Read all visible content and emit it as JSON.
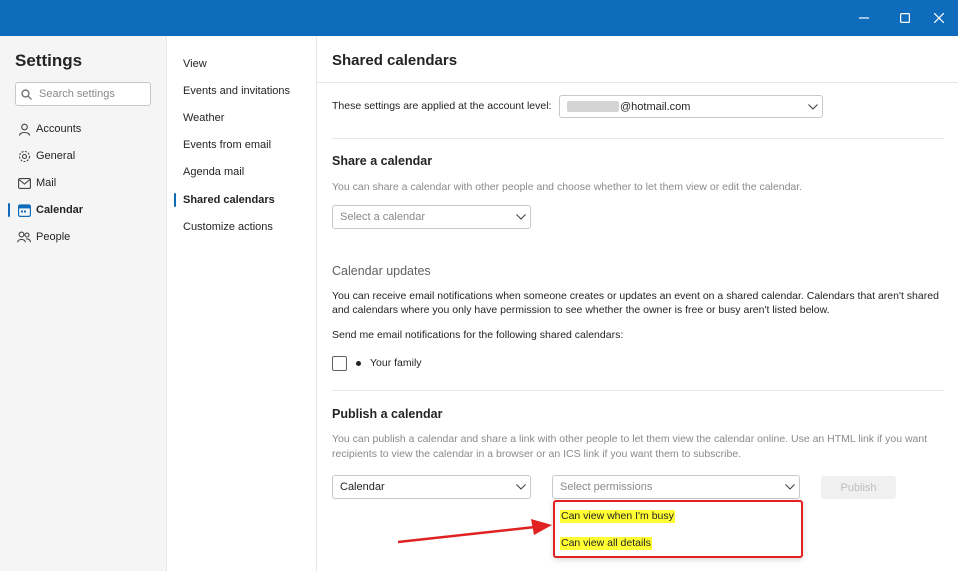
{
  "window": {
    "controls": [
      "minimize",
      "maximize",
      "close"
    ]
  },
  "sidebar": {
    "title": "Settings",
    "search_placeholder": "Search settings",
    "items": [
      {
        "label": "Accounts",
        "icon": "person-icon"
      },
      {
        "label": "General",
        "icon": "gear-icon"
      },
      {
        "label": "Mail",
        "icon": "mail-icon"
      },
      {
        "label": "Calendar",
        "icon": "calendar-icon",
        "active": true
      },
      {
        "label": "People",
        "icon": "people-icon"
      }
    ]
  },
  "subnav": {
    "items": [
      {
        "label": "View"
      },
      {
        "label": "Events and invitations"
      },
      {
        "label": "Weather"
      },
      {
        "label": "Events from email"
      },
      {
        "label": "Agenda mail"
      },
      {
        "label": "Shared calendars",
        "active": true
      },
      {
        "label": "Customize actions"
      }
    ]
  },
  "main": {
    "title": "Shared calendars",
    "account_label": "These settings are applied at the account level:",
    "account_value": "@hotmail.com",
    "share": {
      "heading": "Share a calendar",
      "description": "You can share a calendar with other people and choose whether to let them view or edit the calendar.",
      "select_placeholder": "Select a calendar"
    },
    "updates": {
      "heading": "Calendar updates",
      "description_line1": "You can receive email notifications when someone creates or updates an event on a shared calendar. Calendars that aren't shared",
      "description_line2": "and calendars where you only have permission to see whether the owner is free or busy aren't listed below.",
      "prompt": "Send me email notifications for the following shared calendars:",
      "calendar_item": "Your family"
    },
    "publish": {
      "heading": "Publish a calendar",
      "description_line1": "You can publish a calendar and share a link with other people to let them view the calendar online. Use an HTML link if you want",
      "description_line2": "recipients to view the calendar in a browser or an ICS link if you want them to subscribe.",
      "calendar_value": "Calendar",
      "permissions_placeholder": "Select permissions",
      "publish_button": "Publish",
      "options": [
        "Can view when I'm busy",
        "Can view all details"
      ]
    }
  },
  "colors": {
    "titlebar": "#0f6cbd",
    "accent": "#0f6cbd",
    "annotation_red": "#e02222",
    "highlight": "#ffff33"
  }
}
